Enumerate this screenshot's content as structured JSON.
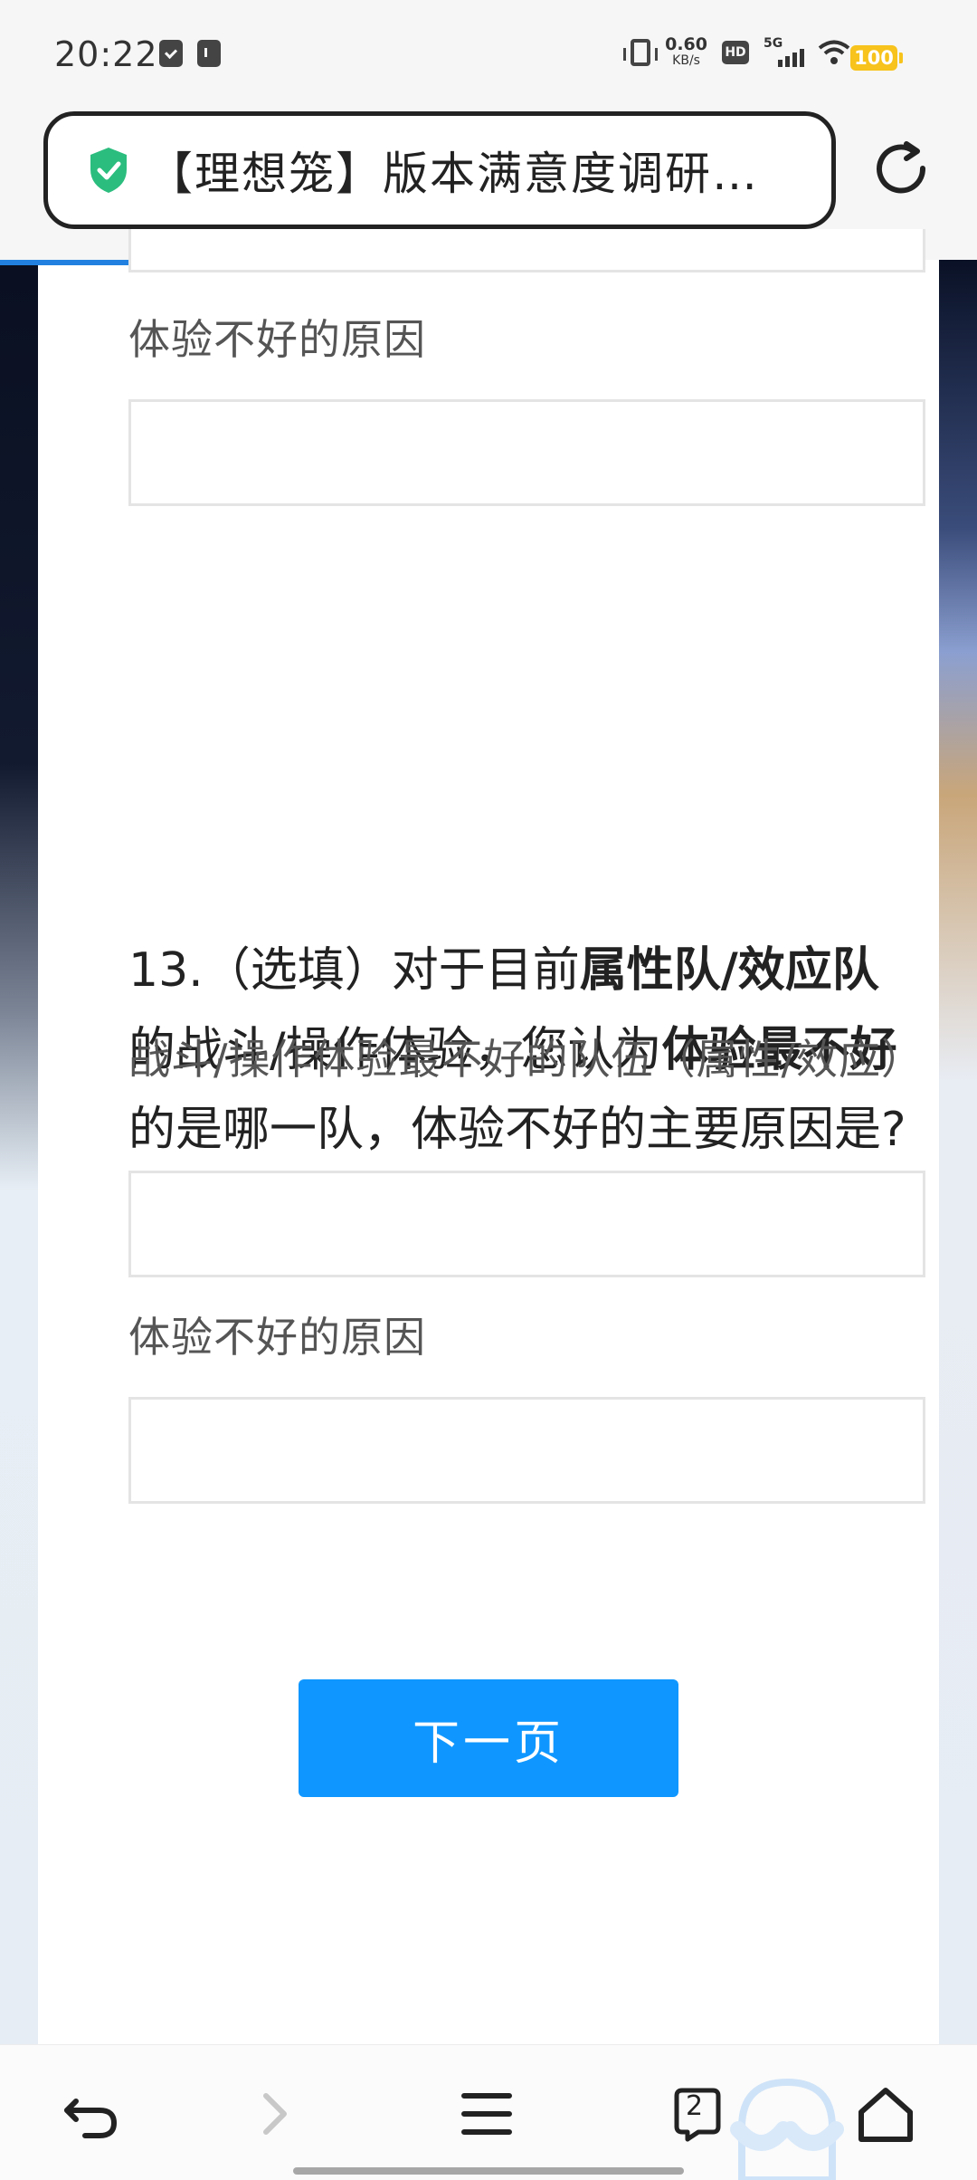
{
  "status_bar": {
    "time": "20:22",
    "speed_value": "0.60",
    "speed_unit": "KB/s",
    "hd": "HD",
    "network": "5G",
    "battery": "100"
  },
  "browser": {
    "title": "【理想笼】版本满意度调研问卷",
    "secure_icon": "shield-check-icon",
    "reload_icon": "reload-icon",
    "tab_count": "2"
  },
  "form": {
    "q12_reason_label": "体验不好的原因",
    "q13": {
      "number": "13.",
      "optional": "（选填）",
      "text_1": "对于目前",
      "bold_1": "属性队/效应队",
      "text_2": "的战斗/操作体验，您认为",
      "bold_2": "体验最不好",
      "text_3": "的是哪一队，体验不好的主要原因是?",
      "team_label": "战斗/操作体验最不好的队伍（属性/效应）",
      "reason_label": "体验不好的原因"
    },
    "next_button": "下一页"
  },
  "colors": {
    "button": "#0f97ff",
    "progress": "#2281e0",
    "shield": "#2bbd7e"
  }
}
